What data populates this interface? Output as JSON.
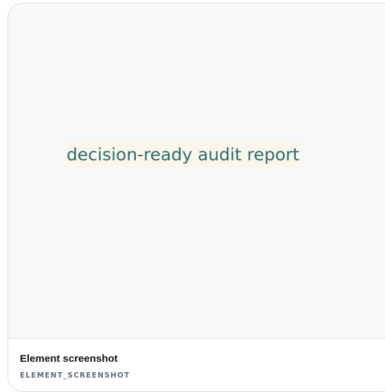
{
  "card": {
    "preview_text": "decision-ready audit report",
    "title": "Element screenshot",
    "code": "ELEMENT_SCREENSHOT"
  },
  "colors": {
    "preview_background": "#f7f8fa",
    "text_highlight": "#faf6ec",
    "text_color": "#2c6b6d",
    "border": "#d4dde8",
    "caption_code": "#5b6b7d"
  }
}
